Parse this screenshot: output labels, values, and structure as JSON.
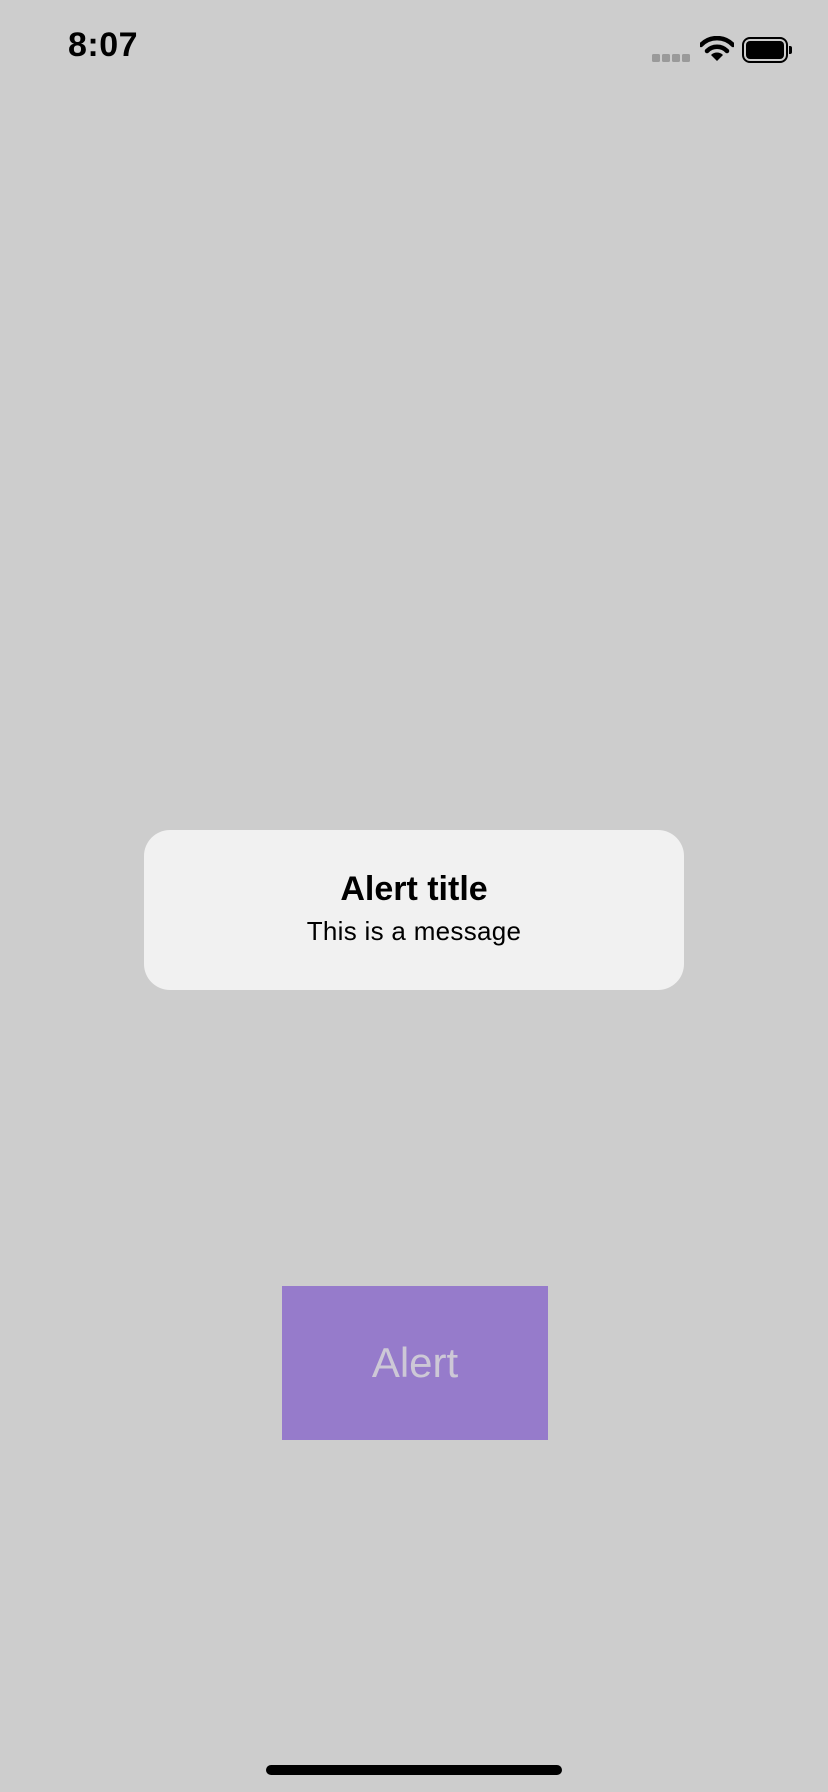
{
  "status_bar": {
    "time": "8:07",
    "icons": [
      "cellular-signal-icon",
      "wifi-icon",
      "battery-icon"
    ]
  },
  "alert": {
    "title": "Alert title",
    "message": "This is a message"
  },
  "main": {
    "button_label": "Alert"
  },
  "colors": {
    "background": "#cdcdcd",
    "alert_background": "#f1f1f1",
    "button_background": "#967bcb",
    "button_text": "#cdc8d6"
  }
}
